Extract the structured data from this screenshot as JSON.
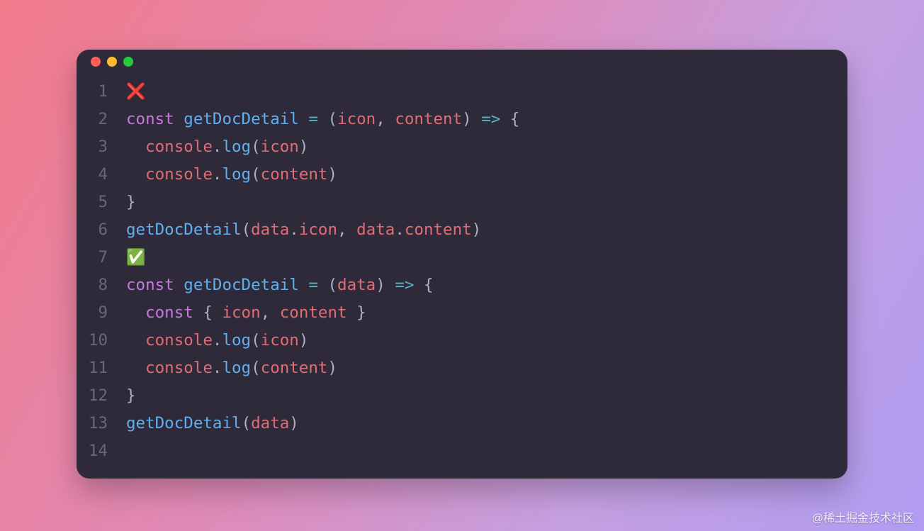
{
  "watermark": "@稀土掘金技术社区",
  "traffic_lights": [
    "close",
    "minimize",
    "zoom"
  ],
  "lines": [
    {
      "n": "1",
      "tokens": [
        {
          "t": "❌",
          "c": "emoji"
        }
      ]
    },
    {
      "n": "2",
      "tokens": [
        {
          "t": "const ",
          "c": "tok-kw"
        },
        {
          "t": "getDocDetail",
          "c": "tok-fn"
        },
        {
          "t": " ",
          "c": "tok-pun"
        },
        {
          "t": "=",
          "c": "tok-op"
        },
        {
          "t": " ",
          "c": "tok-pun"
        },
        {
          "t": "(",
          "c": "tok-pun"
        },
        {
          "t": "icon",
          "c": "tok-id"
        },
        {
          "t": ", ",
          "c": "tok-pun"
        },
        {
          "t": "content",
          "c": "tok-id"
        },
        {
          "t": ") ",
          "c": "tok-pun"
        },
        {
          "t": "=>",
          "c": "tok-op"
        },
        {
          "t": " {",
          "c": "tok-pun"
        }
      ]
    },
    {
      "n": "3",
      "tokens": [
        {
          "t": "  ",
          "c": "tok-pun"
        },
        {
          "t": "console",
          "c": "tok-id"
        },
        {
          "t": ".",
          "c": "tok-dot"
        },
        {
          "t": "log",
          "c": "tok-fn"
        },
        {
          "t": "(",
          "c": "tok-pun"
        },
        {
          "t": "icon",
          "c": "tok-id"
        },
        {
          "t": ")",
          "c": "tok-pun"
        }
      ]
    },
    {
      "n": "4",
      "tokens": [
        {
          "t": "  ",
          "c": "tok-pun"
        },
        {
          "t": "console",
          "c": "tok-id"
        },
        {
          "t": ".",
          "c": "tok-dot"
        },
        {
          "t": "log",
          "c": "tok-fn"
        },
        {
          "t": "(",
          "c": "tok-pun"
        },
        {
          "t": "content",
          "c": "tok-id"
        },
        {
          "t": ")",
          "c": "tok-pun"
        }
      ]
    },
    {
      "n": "5",
      "tokens": [
        {
          "t": "}",
          "c": "tok-pun"
        }
      ]
    },
    {
      "n": "6",
      "tokens": [
        {
          "t": "getDocDetail",
          "c": "tok-fn"
        },
        {
          "t": "(",
          "c": "tok-pun"
        },
        {
          "t": "data",
          "c": "tok-id"
        },
        {
          "t": ".",
          "c": "tok-dot"
        },
        {
          "t": "icon",
          "c": "tok-id"
        },
        {
          "t": ", ",
          "c": "tok-pun"
        },
        {
          "t": "data",
          "c": "tok-id"
        },
        {
          "t": ".",
          "c": "tok-dot"
        },
        {
          "t": "content",
          "c": "tok-id"
        },
        {
          "t": ")",
          "c": "tok-pun"
        }
      ]
    },
    {
      "n": "7",
      "tokens": [
        {
          "t": "✅",
          "c": "emoji"
        }
      ]
    },
    {
      "n": "8",
      "tokens": [
        {
          "t": "const ",
          "c": "tok-kw"
        },
        {
          "t": "getDocDetail",
          "c": "tok-fn"
        },
        {
          "t": " ",
          "c": "tok-pun"
        },
        {
          "t": "=",
          "c": "tok-op"
        },
        {
          "t": " ",
          "c": "tok-pun"
        },
        {
          "t": "(",
          "c": "tok-pun"
        },
        {
          "t": "data",
          "c": "tok-id"
        },
        {
          "t": ") ",
          "c": "tok-pun"
        },
        {
          "t": "=>",
          "c": "tok-op"
        },
        {
          "t": " {",
          "c": "tok-pun"
        }
      ]
    },
    {
      "n": "9",
      "tokens": [
        {
          "t": "  ",
          "c": "tok-pun"
        },
        {
          "t": "const ",
          "c": "tok-kw"
        },
        {
          "t": "{ ",
          "c": "tok-pun"
        },
        {
          "t": "icon",
          "c": "tok-id"
        },
        {
          "t": ", ",
          "c": "tok-pun"
        },
        {
          "t": "content",
          "c": "tok-id"
        },
        {
          "t": " }",
          "c": "tok-pun"
        }
      ]
    },
    {
      "n": "10",
      "tokens": [
        {
          "t": "  ",
          "c": "tok-pun"
        },
        {
          "t": "console",
          "c": "tok-id"
        },
        {
          "t": ".",
          "c": "tok-dot"
        },
        {
          "t": "log",
          "c": "tok-fn"
        },
        {
          "t": "(",
          "c": "tok-pun"
        },
        {
          "t": "icon",
          "c": "tok-id"
        },
        {
          "t": ")",
          "c": "tok-pun"
        }
      ]
    },
    {
      "n": "11",
      "tokens": [
        {
          "t": "  ",
          "c": "tok-pun"
        },
        {
          "t": "console",
          "c": "tok-id"
        },
        {
          "t": ".",
          "c": "tok-dot"
        },
        {
          "t": "log",
          "c": "tok-fn"
        },
        {
          "t": "(",
          "c": "tok-pun"
        },
        {
          "t": "content",
          "c": "tok-id"
        },
        {
          "t": ")",
          "c": "tok-pun"
        }
      ]
    },
    {
      "n": "12",
      "tokens": [
        {
          "t": "}",
          "c": "tok-pun"
        }
      ]
    },
    {
      "n": "13",
      "tokens": [
        {
          "t": "getDocDetail",
          "c": "tok-fn"
        },
        {
          "t": "(",
          "c": "tok-pun"
        },
        {
          "t": "data",
          "c": "tok-id"
        },
        {
          "t": ")",
          "c": "tok-pun"
        }
      ]
    },
    {
      "n": "14",
      "tokens": [
        {
          "t": "",
          "c": "tok-pun"
        }
      ]
    }
  ]
}
